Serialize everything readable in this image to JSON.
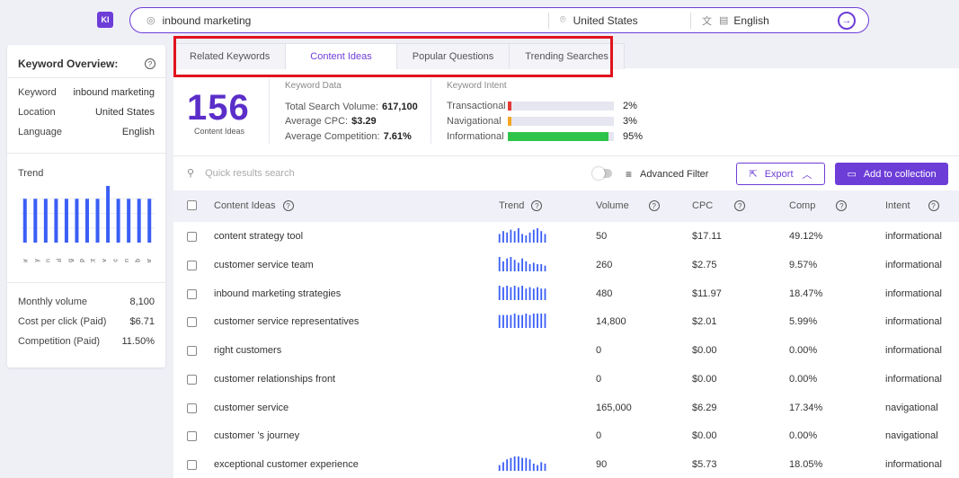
{
  "app": {
    "logo_text": "KI"
  },
  "search": {
    "query": "inbound marketing",
    "location": "United States",
    "language": "English"
  },
  "overview": {
    "title": "Keyword Overview:",
    "rows": [
      {
        "label": "Keyword",
        "value": "inbound marketing"
      },
      {
        "label": "Location",
        "value": "United States"
      },
      {
        "label": "Language",
        "value": "English"
      }
    ],
    "trend_label": "Trend",
    "trend_values": [
      0.75,
      0.75,
      0.75,
      0.75,
      0.75,
      0.75,
      0.75,
      0.75,
      0.97,
      0.75,
      0.75,
      0.75,
      0.75
    ],
    "months": [
      "Apr",
      "May",
      "Jun",
      "Jul",
      "Aug",
      "Sep",
      "Oct",
      "Nov",
      "Dec",
      "Jan",
      "Feb",
      "Mar"
    ],
    "stats": [
      {
        "label": "Monthly volume",
        "value": "8,100"
      },
      {
        "label": "Cost per click (Paid)",
        "value": "$6.71"
      },
      {
        "label": "Competition (Paid)",
        "value": "11.50%"
      }
    ]
  },
  "tabs": [
    "Related Keywords",
    "Content Ideas",
    "Popular Questions",
    "Trending Searches"
  ],
  "active_tab": 1,
  "summary": {
    "count": "156",
    "count_label": "Content Ideas",
    "keyword_data_title": "Keyword Data",
    "keyword_data": [
      {
        "label": "Total Search Volume:",
        "value": "617,100"
      },
      {
        "label": "Average CPC:",
        "value": "$3.29"
      },
      {
        "label": "Average Competition:",
        "value": "7.61%"
      }
    ],
    "intent_title": "Keyword Intent",
    "intents": [
      {
        "label": "Transactional",
        "pct": "2%",
        "fraction": 0.02,
        "color": "#e53935"
      },
      {
        "label": "Navigational",
        "pct": "3%",
        "fraction": 0.03,
        "color": "#f5a623"
      },
      {
        "label": "Informational",
        "pct": "95%",
        "fraction": 0.95,
        "color": "#2ec44a"
      }
    ]
  },
  "toolbar": {
    "search_placeholder": "Quick results search",
    "advanced_filter": "Advanced Filter",
    "export": "Export",
    "add_collection": "Add to collection"
  },
  "table": {
    "headers": [
      "Content Ideas",
      "Trend",
      "Volume",
      "CPC",
      "Comp",
      "Intent"
    ],
    "rows": [
      {
        "idea": "content strategy tool",
        "volume": "50",
        "cpc": "$17.11",
        "comp": "49.12%",
        "intent": "informational",
        "trend": [
          0.6,
          0.8,
          0.7,
          0.9,
          0.8,
          1,
          0.6,
          0.5,
          0.7,
          0.9,
          1,
          0.8,
          0.6
        ]
      },
      {
        "idea": "customer service team",
        "volume": "260",
        "cpc": "$2.75",
        "comp": "9.57%",
        "intent": "informational",
        "trend": [
          1,
          0.7,
          0.9,
          1,
          0.8,
          0.6,
          0.9,
          0.7,
          0.5,
          0.6,
          0.5,
          0.5,
          0.4
        ]
      },
      {
        "idea": "inbound marketing strategies",
        "volume": "480",
        "cpc": "$11.97",
        "comp": "18.47%",
        "intent": "informational",
        "trend": [
          1,
          0.9,
          1,
          0.9,
          1,
          0.9,
          1,
          0.8,
          0.9,
          0.8,
          0.9,
          0.8,
          0.8
        ]
      },
      {
        "idea": "customer service representatives",
        "volume": "14,800",
        "cpc": "$2.01",
        "comp": "5.99%",
        "intent": "informational",
        "trend": [
          0.9,
          0.9,
          0.9,
          0.9,
          1,
          0.9,
          0.9,
          1,
          0.9,
          1,
          1,
          1,
          1
        ]
      },
      {
        "idea": "right customers",
        "volume": "0",
        "cpc": "$0.00",
        "comp": "0.00%",
        "intent": "informational",
        "trend": []
      },
      {
        "idea": "customer relationships front",
        "volume": "0",
        "cpc": "$0.00",
        "comp": "0.00%",
        "intent": "informational",
        "trend": []
      },
      {
        "idea": "customer service",
        "volume": "165,000",
        "cpc": "$6.29",
        "comp": "17.34%",
        "intent": "navigational",
        "trend": []
      },
      {
        "idea": "customer ’s journey",
        "volume": "0",
        "cpc": "$0.00",
        "comp": "0.00%",
        "intent": "navigational",
        "trend": []
      },
      {
        "idea": "exceptional customer experience",
        "volume": "90",
        "cpc": "$5.73",
        "comp": "18.05%",
        "intent": "informational",
        "trend": [
          0.4,
          0.6,
          0.8,
          0.9,
          1,
          1,
          0.9,
          0.9,
          0.8,
          0.5,
          0.4,
          0.6,
          0.5
        ]
      }
    ]
  },
  "colors": {
    "accent": "#6d3dd8",
    "bars": "#3a5ef5",
    "highlight": "#e0141e"
  }
}
